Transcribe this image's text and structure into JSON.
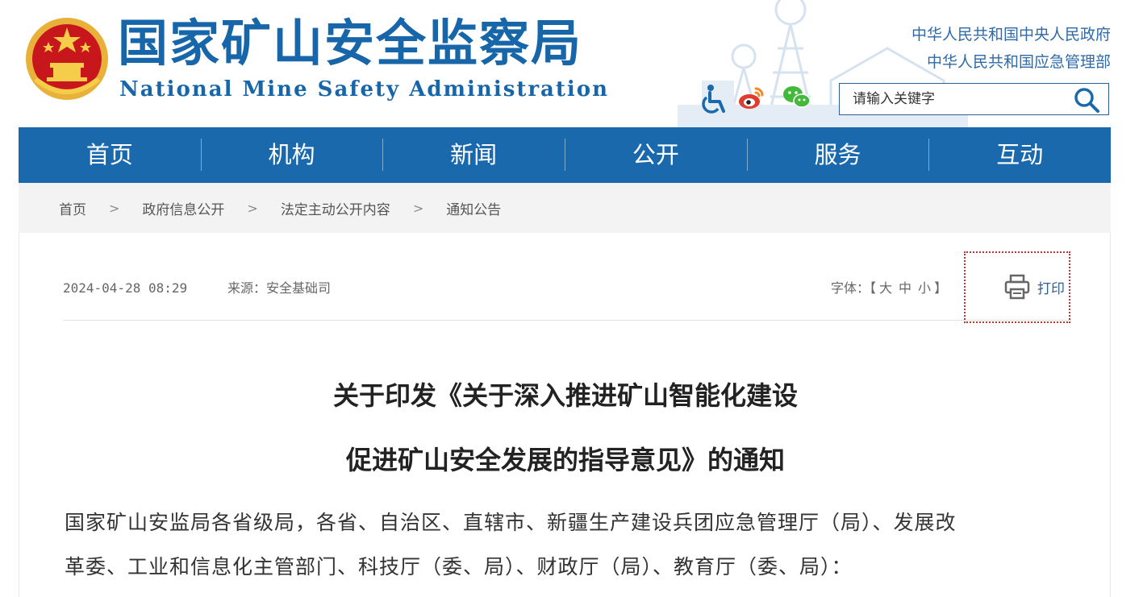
{
  "header": {
    "title_cn": "国家矿山安全监察局",
    "title_en": "National Mine Safety Administration",
    "links": [
      "中华人民共和国中央人民政府",
      "中华人民共和国应急管理部"
    ],
    "icons": [
      "accessibility-icon",
      "weibo-icon",
      "wechat-icon"
    ],
    "search": {
      "placeholder": "请输入关键字"
    }
  },
  "nav": {
    "items": [
      "首页",
      "机构",
      "新闻",
      "公开",
      "服务",
      "互动"
    ]
  },
  "breadcrumb": {
    "items": [
      "首页",
      "政府信息公开",
      "法定主动公开内容",
      "通知公告"
    ],
    "separator": ">"
  },
  "article": {
    "datetime": "2024-04-28 08:29",
    "source": "来源：安全基础司",
    "font_label": "字体：【",
    "font_options": [
      "大",
      "中",
      "小"
    ],
    "font_close": "】",
    "print_label": "打印",
    "title_lines": [
      "关于印发《关于深入推进矿山智能化建设",
      "促进矿山安全发展的指导意见》的通知"
    ],
    "body_lines": [
      "国家矿山安监局各省级局，各省、自治区、直辖市、新疆生产建设兵团应急管理厅（局）、发展改",
      "革委、工业和信息化主管部门、科技厅（委、局）、财政厅（局）、教育厅（委、局）："
    ]
  },
  "colors": {
    "brand_blue": "#1b69ad",
    "title_blue": "#1766aa",
    "link_blue": "#2f6aa8"
  }
}
